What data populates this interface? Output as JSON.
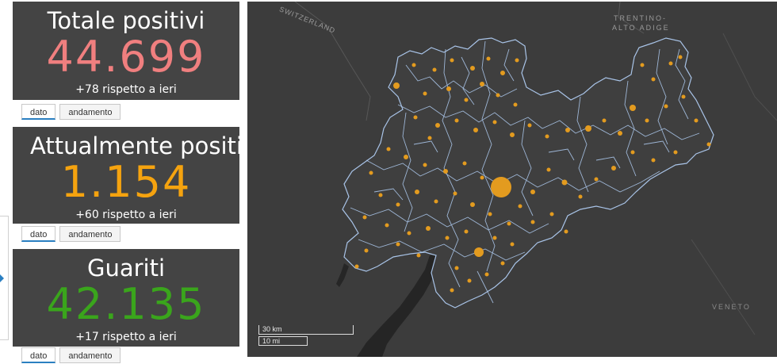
{
  "cards": [
    {
      "title": "Totale positivi",
      "value": "44.699",
      "delta": "+78 rispetto a ieri",
      "color": "#f07f7f"
    },
    {
      "title": "Attualmente positivi",
      "value": "1.154",
      "delta": "+60 rispetto a ieri",
      "color": "#f5a30f"
    },
    {
      "title": "Guariti",
      "value": "42.135",
      "delta": "+17 rispetto a ieri",
      "color": "#3aa51c"
    }
  ],
  "tabs": {
    "dato": "dato",
    "andamento": "andamento"
  },
  "map": {
    "labels": {
      "switzerland": "SWITZERLAND",
      "region_line1": "TRENTINO-",
      "region_line2": "ALTO ADIGE",
      "veneto": "VENETO"
    },
    "scale_km": "30 km",
    "scale_mi": "10 mi",
    "dot_color": "#e39b1f",
    "border_color": "#a9c4e8"
  }
}
